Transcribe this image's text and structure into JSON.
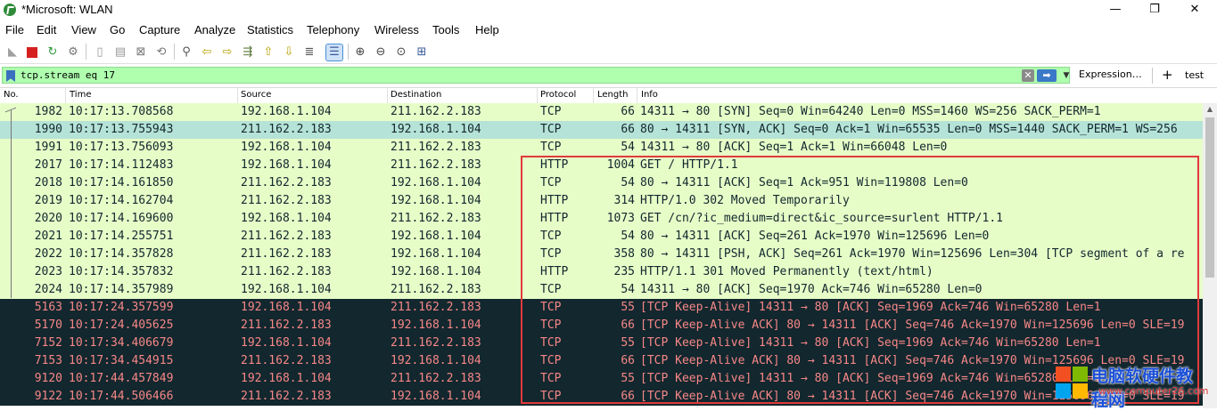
{
  "window": {
    "title": "*Microsoft: WLAN",
    "minimize": "—",
    "restore": "❐",
    "close": "✕"
  },
  "menu": [
    "File",
    "Edit",
    "View",
    "Go",
    "Capture",
    "Analyze",
    "Statistics",
    "Telephony",
    "Wireless",
    "Tools",
    "Help"
  ],
  "filter": {
    "value": "tcp.stream eq 17",
    "expression_label": "Expression…",
    "plus_label": "+",
    "test_label": "test"
  },
  "columns": {
    "no": "No.",
    "time": "Time",
    "source": "Source",
    "destination": "Destination",
    "protocol": "Protocol",
    "length": "Length",
    "info": "Info"
  },
  "packets": [
    {
      "no": "1982",
      "time": "10:17:13.708568",
      "src": "192.168.1.104",
      "dst": "211.162.2.183",
      "proto": "TCP",
      "len": "66",
      "info": "14311 → 80 [SYN] Seq=0 Win=64240 Len=0 MSS=1460 WS=256 SACK_PERM=1",
      "style": "tcp"
    },
    {
      "no": "1990",
      "time": "10:17:13.755943",
      "src": "211.162.2.183",
      "dst": "192.168.1.104",
      "proto": "TCP",
      "len": "66",
      "info": "80 → 14311 [SYN, ACK] Seq=0 Ack=1 Win=65535 Len=0 MSS=1440 SACK_PERM=1 WS=256",
      "style": "selected"
    },
    {
      "no": "1991",
      "time": "10:17:13.756093",
      "src": "192.168.1.104",
      "dst": "211.162.2.183",
      "proto": "TCP",
      "len": "54",
      "info": "14311 → 80 [ACK] Seq=1 Ack=1 Win=66048 Len=0",
      "style": "tcp"
    },
    {
      "no": "2017",
      "time": "10:17:14.112483",
      "src": "192.168.1.104",
      "dst": "211.162.2.183",
      "proto": "HTTP",
      "len": "1004",
      "info": "GET / HTTP/1.1",
      "style": "http"
    },
    {
      "no": "2018",
      "time": "10:17:14.161850",
      "src": "211.162.2.183",
      "dst": "192.168.1.104",
      "proto": "TCP",
      "len": "54",
      "info": "80 → 14311 [ACK] Seq=1 Ack=951 Win=119808 Len=0",
      "style": "tcp"
    },
    {
      "no": "2019",
      "time": "10:17:14.162704",
      "src": "211.162.2.183",
      "dst": "192.168.1.104",
      "proto": "HTTP",
      "len": "314",
      "info": "HTTP/1.0 302 Moved Temporarily",
      "style": "http"
    },
    {
      "no": "2020",
      "time": "10:17:14.169600",
      "src": "192.168.1.104",
      "dst": "211.162.2.183",
      "proto": "HTTP",
      "len": "1073",
      "info": "GET /cn/?ic_medium=direct&ic_source=surlent HTTP/1.1",
      "style": "http"
    },
    {
      "no": "2021",
      "time": "10:17:14.255751",
      "src": "211.162.2.183",
      "dst": "192.168.1.104",
      "proto": "TCP",
      "len": "54",
      "info": "80 → 14311 [ACK] Seq=261 Ack=1970 Win=125696 Len=0",
      "style": "tcp"
    },
    {
      "no": "2022",
      "time": "10:17:14.357828",
      "src": "211.162.2.183",
      "dst": "192.168.1.104",
      "proto": "TCP",
      "len": "358",
      "info": "80 → 14311 [PSH, ACK] Seq=261 Ack=1970 Win=125696 Len=304 [TCP segment of a re",
      "style": "tcp"
    },
    {
      "no": "2023",
      "time": "10:17:14.357832",
      "src": "211.162.2.183",
      "dst": "192.168.1.104",
      "proto": "HTTP",
      "len": "235",
      "info": "HTTP/1.1 301 Moved Permanently  (text/html)",
      "style": "http"
    },
    {
      "no": "2024",
      "time": "10:17:14.357989",
      "src": "192.168.1.104",
      "dst": "211.162.2.183",
      "proto": "TCP",
      "len": "54",
      "info": "14311 → 80 [ACK] Seq=1970 Ack=746 Win=65280 Len=0",
      "style": "tcp"
    },
    {
      "no": "5163",
      "time": "10:17:24.357599",
      "src": "192.168.1.104",
      "dst": "211.162.2.183",
      "proto": "TCP",
      "len": "55",
      "info": "[TCP Keep-Alive] 14311 → 80 [ACK] Seq=1969 Ack=746 Win=65280 Len=1",
      "style": "bad"
    },
    {
      "no": "5170",
      "time": "10:17:24.405625",
      "src": "211.162.2.183",
      "dst": "192.168.1.104",
      "proto": "TCP",
      "len": "66",
      "info": "[TCP Keep-Alive ACK] 80 → 14311 [ACK] Seq=746 Ack=1970 Win=125696 Len=0 SLE=19",
      "style": "bad"
    },
    {
      "no": "7152",
      "time": "10:17:34.406679",
      "src": "192.168.1.104",
      "dst": "211.162.2.183",
      "proto": "TCP",
      "len": "55",
      "info": "[TCP Keep-Alive] 14311 → 80 [ACK] Seq=1969 Ack=746 Win=65280 Len=1",
      "style": "bad"
    },
    {
      "no": "7153",
      "time": "10:17:34.454915",
      "src": "211.162.2.183",
      "dst": "192.168.1.104",
      "proto": "TCP",
      "len": "66",
      "info": "[TCP Keep-Alive ACK] 80 → 14311 [ACK] Seq=746 Ack=1970 Win=125696 Len=0 SLE=19",
      "style": "bad"
    },
    {
      "no": "9120",
      "time": "10:17:44.457849",
      "src": "192.168.1.104",
      "dst": "211.162.2.183",
      "proto": "TCP",
      "len": "55",
      "info": "[TCP Keep-Alive] 14311 → 80 [ACK] Seq=1969 Ack=746 Win=65280 Len=1",
      "style": "bad"
    },
    {
      "no": "9122",
      "time": "10:17:44.506466",
      "src": "211.162.2.183",
      "dst": "192.168.1.104",
      "proto": "TCP",
      "len": "66",
      "info": "[TCP Keep-Alive ACK] 80 → 14311 [ACK] Seq=746 Ack=1970 Win=125696 Len=0 SLE=19",
      "style": "bad"
    }
  ],
  "watermark": {
    "brand": "电脑软硬件教程网",
    "url": "www.computer26.com"
  },
  "colors": {
    "tcp_row": "#e7fdc8",
    "selected_row": "#b6e3d7",
    "bad_row_bg": "#12272e",
    "bad_row_fg": "#f78787",
    "filter_ok": "#afffaf",
    "highlight_box": "#e03a3a"
  }
}
